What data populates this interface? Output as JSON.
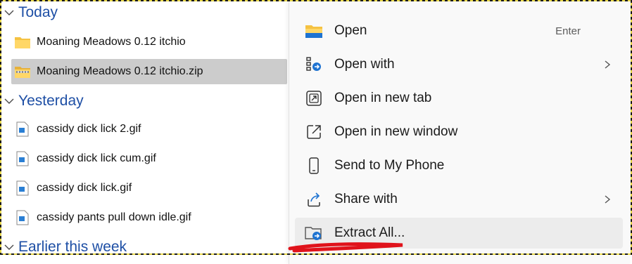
{
  "file_list": {
    "groups": [
      {
        "header": "Today",
        "items": [
          {
            "name": "Moaning Meadows 0.12 itchio",
            "icon": "folder-icon"
          },
          {
            "name": "Moaning Meadows 0.12 itchio.zip",
            "icon": "zip-folder-icon",
            "selected": true
          }
        ]
      },
      {
        "header": "Yesterday",
        "items": [
          {
            "name": "cassidy dick lick 2.gif",
            "icon": "gif-file-icon"
          },
          {
            "name": "cassidy dick lick cum.gif",
            "icon": "gif-file-icon"
          },
          {
            "name": "cassidy dick lick.gif",
            "icon": "gif-file-icon"
          },
          {
            "name": "cassidy pants pull down idle.gif",
            "icon": "gif-file-icon"
          }
        ]
      },
      {
        "header": "Earlier this week",
        "items": []
      }
    ]
  },
  "context_menu": {
    "items": [
      {
        "label": "Open",
        "shortcut": "Enter",
        "icon": "folder-open-icon"
      },
      {
        "label": "Open with",
        "icon": "open-with-icon",
        "submenu": true
      },
      {
        "label": "Open in new tab",
        "icon": "new-tab-icon"
      },
      {
        "label": "Open in new window",
        "icon": "new-window-icon"
      },
      {
        "label": "Send to My Phone",
        "icon": "phone-icon"
      },
      {
        "label": "Share with",
        "icon": "share-icon",
        "submenu": true
      },
      {
        "label": "Extract All...",
        "icon": "extract-icon",
        "hovered": true
      }
    ]
  },
  "colors": {
    "group_header": "#1e4fa5",
    "selected_row": "#cccccc",
    "menu_background": "#f9f9f9",
    "annotation": "#e0131b"
  }
}
